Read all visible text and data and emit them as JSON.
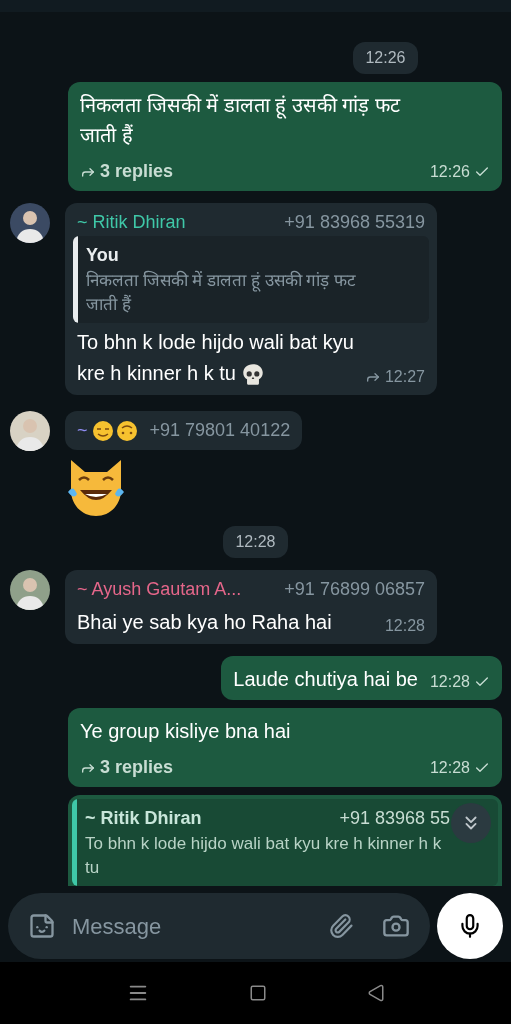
{
  "messages": [
    {
      "kind": "date",
      "text": "12:26"
    },
    {
      "kind": "outgoing",
      "text": "निकलता जिसकी में डालता हूं उसकी गांड़ फट जाती हैं",
      "replies": "3 replies",
      "time": "12:26",
      "sent": true
    },
    {
      "kind": "incoming",
      "sender": "~ Ritik Dhiran",
      "color": "#3fc8a8",
      "phone": "+91 83968 55319",
      "quote": {
        "author": "You",
        "text": "निकलता जिसकी में डालता हूं उसकी गांड़ फट जाती हैं"
      },
      "text": "To bhn k lode hijdo wali bat kyu kre h  kinner h k tu",
      "time": "12:27"
    },
    {
      "kind": "sticker",
      "sender": "~",
      "color": "#8f8cf2",
      "phone": "+91 79801 40122"
    },
    {
      "kind": "date",
      "text": "12:28"
    },
    {
      "kind": "incoming",
      "sender": "~ Ayush Gautam A...",
      "color": "#e5668a",
      "phone": "+91 76899 06857",
      "text": "Bhai ye sab kya ho Raha hai",
      "time": "12:28"
    },
    {
      "kind": "outgoing",
      "text": "Laude chutiya hai be",
      "time": "12:28",
      "sent": true
    },
    {
      "kind": "outgoing",
      "text": "Ye group kisliye bna hai",
      "replies": "3 replies",
      "time": "12:28",
      "sent": true
    },
    {
      "kind": "quote_only",
      "quote": {
        "author": "~ Ritik Dhiran",
        "phone": "+91 83968 55",
        "text": "To bhn k lode hijdo wali bat kyu kre h  kinner h k tu"
      }
    }
  ],
  "composer": {
    "placeholder": "Message"
  }
}
